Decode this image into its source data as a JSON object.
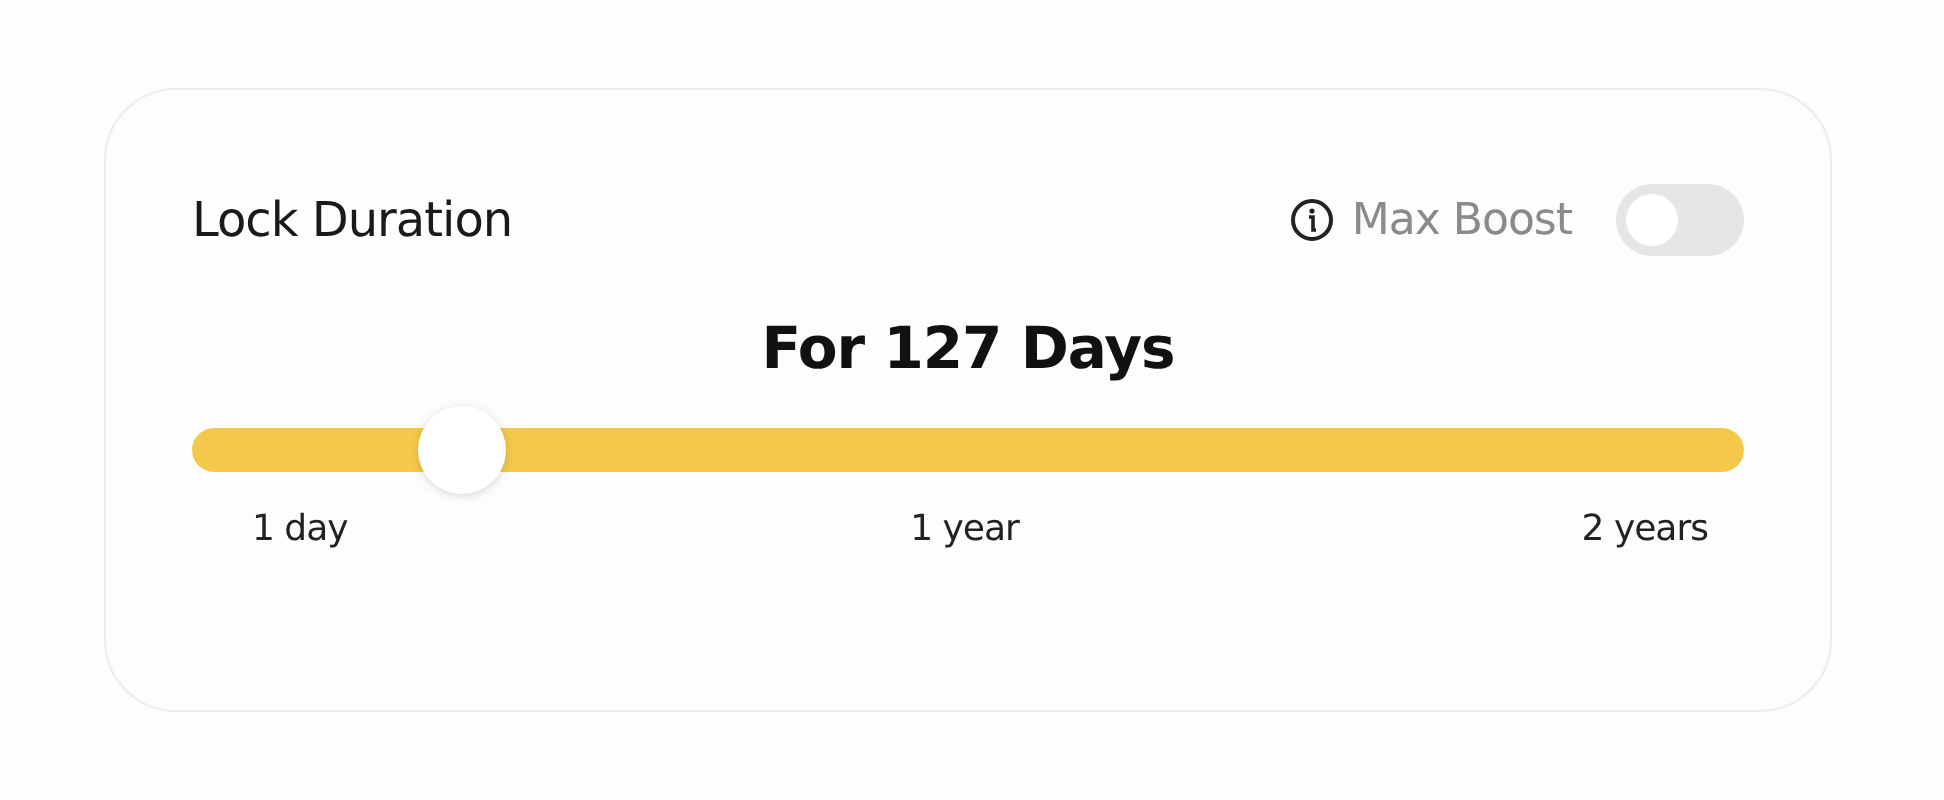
{
  "title": "Lock Duration",
  "max_boost": {
    "label": "Max Boost",
    "on": false
  },
  "duration": "For 127 Days",
  "slider": {
    "level": 0.174
  },
  "marks": [
    "1 day",
    "1 year",
    "2 years"
  ]
}
